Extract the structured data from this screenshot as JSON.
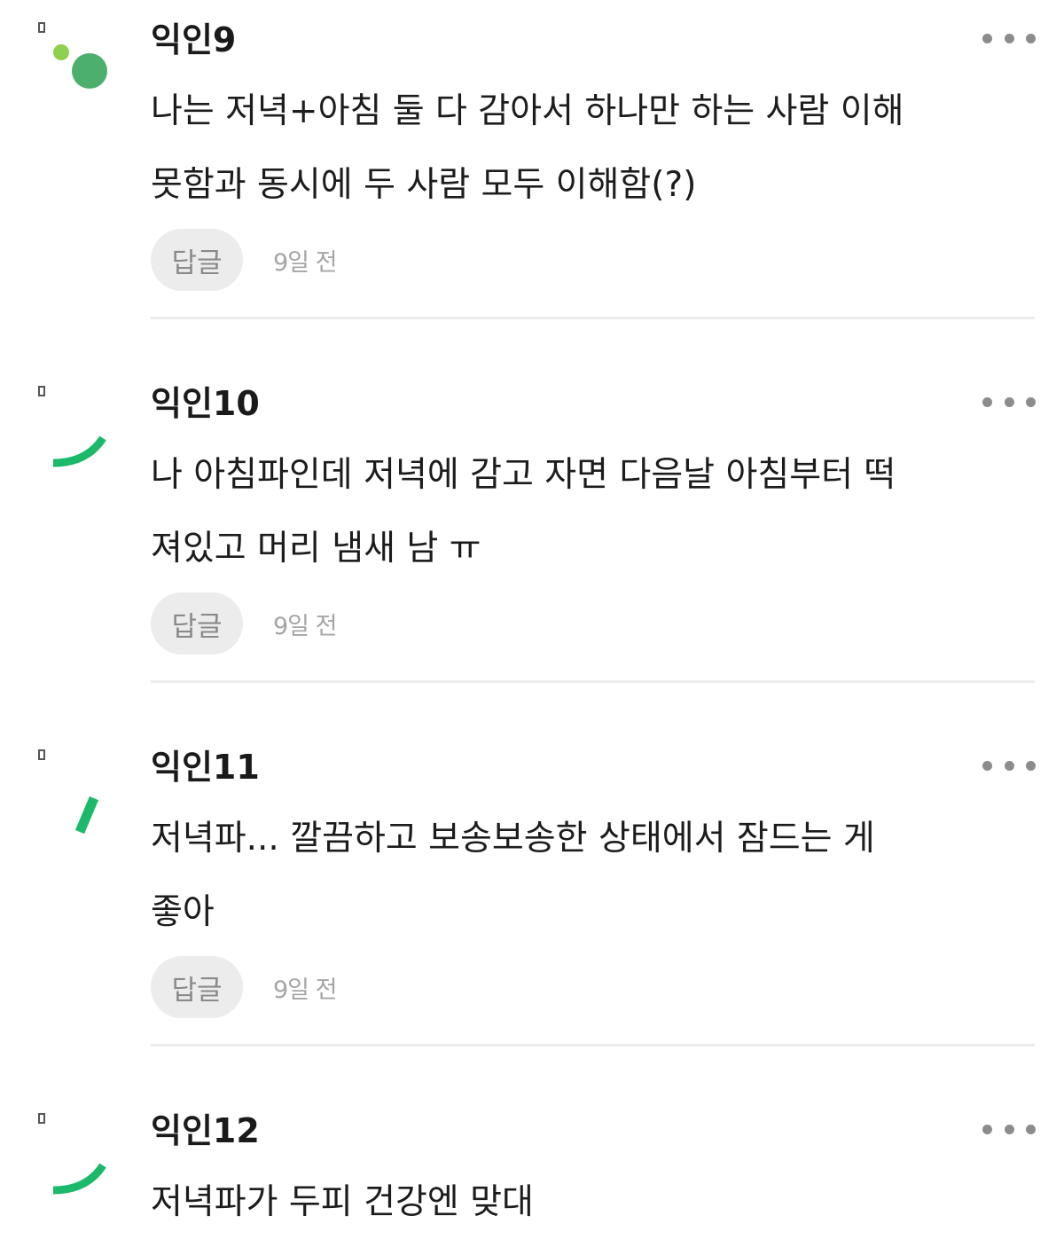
{
  "colors": {
    "avatar_green_light": "#8fd14f",
    "avatar_green_dark": "#4caf6e",
    "avatar_green_stroke": "#1db96a",
    "reply_button_bg": "#ececec",
    "divider": "#ececec"
  },
  "comments": [
    {
      "nickname": "익인9",
      "lines": [
        "나는 저녁+아침 둘 다 감아서 하나만 하는 사람 이해",
        "못함과 동시에 두 사람 모두 이해함(?)"
      ],
      "reply_label": "답글",
      "time": "9일 전",
      "avatar_icon": "two-dots-icon"
    },
    {
      "nickname": "익인10",
      "lines": [
        "나 아침파인데 저녁에 감고 자면 다음날 아침부터 떡",
        "져있고 머리 냄새 남 ㅠ"
      ],
      "reply_label": "답글",
      "time": "9일 전",
      "avatar_icon": "arc-icon"
    },
    {
      "nickname": "익인11",
      "lines": [
        "저녁파... 깔끔하고 보송보송한 상태에서 잠드는 게",
        "좋아"
      ],
      "reply_label": "답글",
      "time": "9일 전",
      "avatar_icon": "slash-icon"
    },
    {
      "nickname": "익인12",
      "lines": [
        "저녁파가 두피 건강엔 맞대"
      ],
      "avatar_icon": "arc-icon"
    }
  ]
}
